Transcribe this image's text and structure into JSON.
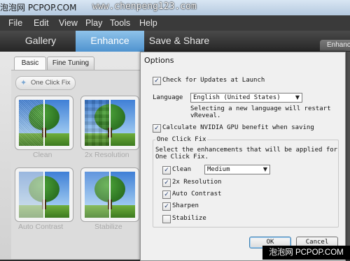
{
  "app_title": "泡泡网 PCPOP.COM",
  "top_watermark": "www.chenpeng123.com",
  "menu": [
    "File",
    "Edit",
    "View",
    "Play",
    "Tools",
    "Help"
  ],
  "mode_tabs": [
    "Gallery",
    "Enhance",
    "Save & Share"
  ],
  "mode_tab_active": "Enhance",
  "enhance_side_tab": "Enhanc",
  "sub_tabs": [
    "Basic",
    "Fine Tuning"
  ],
  "sub_tab_active": "Basic",
  "one_click_fix_label": "One Click Fix",
  "thumbnails": [
    {
      "label": "Clean"
    },
    {
      "label": "2x Resolution"
    },
    {
      "label": "Auto Contrast"
    },
    {
      "label": "Stabilize"
    }
  ],
  "options_dialog": {
    "title": "Options",
    "check_updates_label": "Check for Updates at Launch",
    "check_updates_checked": true,
    "language_label": "Language",
    "language_value": "English (United States)",
    "language_note_line1": "Selecting a new language will restart",
    "language_note_line2": "vReveal.",
    "nvidia_label": "Calculate NVIDIA GPU benefit when saving",
    "nvidia_checked": true,
    "ocf_group_title": "One Click Fix",
    "ocf_desc_line1": "Select the enhancements that will be applied for",
    "ocf_desc_line2": "One Click Fix.",
    "items": [
      {
        "label": "Clean",
        "checked": true,
        "dropdown": "Medium"
      },
      {
        "label": "2x Resolution",
        "checked": true
      },
      {
        "label": "Auto Contrast",
        "checked": true
      },
      {
        "label": "Sharpen",
        "checked": true
      },
      {
        "label": "Stabilize",
        "checked": false
      }
    ],
    "ok_label": "OK",
    "cancel_label": "Cancel"
  },
  "bottom_watermark": "泡泡网 PCPOP.COM",
  "colors": {
    "active_tab": "#5fa3dc",
    "dark_ui": "#333333",
    "dialog_bg": "#f0f0f0"
  }
}
